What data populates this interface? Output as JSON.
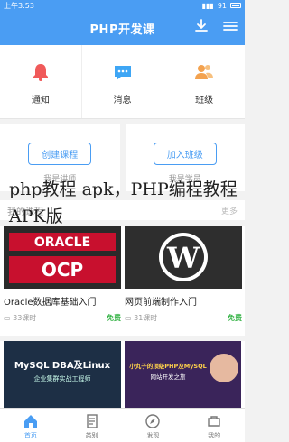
{
  "status": {
    "time": "上午3:53",
    "battery": "91"
  },
  "header": {
    "title": "PHP开发课"
  },
  "features": [
    {
      "label": "通知",
      "icon": "bell-icon",
      "color": "#f05a5a"
    },
    {
      "label": "消息",
      "icon": "chat-icon",
      "color": "#3ea6f5"
    },
    {
      "label": "班级",
      "icon": "group-icon",
      "color": "#f3a24f"
    }
  ],
  "cards": [
    {
      "button": "创建课程",
      "sub": "我是讲师"
    },
    {
      "button": "加入班级",
      "sub": "我是学员"
    }
  ],
  "section": {
    "title": "我的课程",
    "more": "更多"
  },
  "courses": [
    {
      "name": "Oracle数据库基础入门",
      "lessons": "33课时",
      "price": "免费",
      "thumb_text": "ORACLE"
    },
    {
      "name": "网页前端制作入门",
      "lessons": "31课时",
      "price": "免费",
      "thumb_text": "W"
    }
  ],
  "courses2": [
    {
      "thumb_title": "MySQL DBA及Linux",
      "thumb_sub": "企业集群实战工程师"
    },
    {
      "thumb_title": "小丸子的顶级PHP及MySQL",
      "thumb_sub": "网站开发之旅"
    }
  ],
  "overlay": {
    "text": "php教程 apk，PHP编程教程APK版"
  },
  "tabs": [
    {
      "label": "首页",
      "icon": "home-icon",
      "active": true
    },
    {
      "label": "类别",
      "icon": "book-icon",
      "active": false
    },
    {
      "label": "发现",
      "icon": "compass-icon",
      "active": false
    },
    {
      "label": "我的",
      "icon": "user-icon",
      "active": false
    }
  ],
  "colors": {
    "primary": "#4a9df3",
    "free": "#38b449"
  }
}
